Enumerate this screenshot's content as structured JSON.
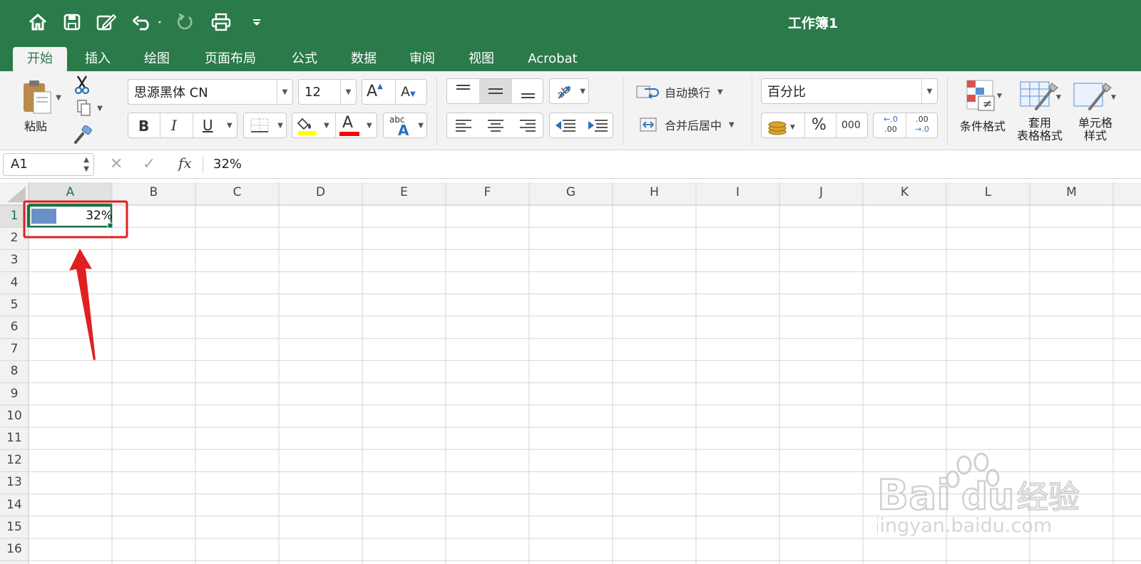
{
  "window": {
    "title": "工作簿1"
  },
  "quick_access": {
    "icons": [
      "home-icon",
      "save-icon",
      "edit-icon",
      "undo-icon",
      "redo-icon",
      "print-icon",
      "customize-icon"
    ]
  },
  "tabs": [
    {
      "label": "开始",
      "active": true
    },
    {
      "label": "插入"
    },
    {
      "label": "绘图"
    },
    {
      "label": "页面布局"
    },
    {
      "label": "公式"
    },
    {
      "label": "数据"
    },
    {
      "label": "审阅"
    },
    {
      "label": "视图"
    },
    {
      "label": "Acrobat"
    }
  ],
  "ribbon": {
    "paste_label": "粘贴",
    "font_name": "思源黑体 CN",
    "font_size": "12",
    "bold": "B",
    "italic": "I",
    "underline": "U",
    "font_color_letter": "A",
    "phonetic_top": "abc",
    "phonetic_letter": "A",
    "wrap_text": "自动换行",
    "merge_center": "合并后居中",
    "number_format": "百分比",
    "percent": "%",
    "comma": "000",
    "increase_decimal_top": "←.0",
    "increase_decimal_bottom": ".00",
    "decrease_decimal_top": ".00",
    "decrease_decimal_bottom": "→.0",
    "conditional_format": "条件格式",
    "format_as_table_line1": "套用",
    "format_as_table_line2": "表格格式",
    "cell_styles_line1": "单元格",
    "cell_styles_line2": "样式",
    "colors": {
      "fill_highlight": "#ffff00",
      "font_color": "#ff0000"
    }
  },
  "formula_bar": {
    "name_box": "A1",
    "fx": "fx",
    "value": "32%"
  },
  "sheet": {
    "columns": [
      "A",
      "B",
      "C",
      "D",
      "E",
      "F",
      "G",
      "H",
      "I",
      "J",
      "K",
      "L",
      "M"
    ],
    "rows": [
      "1",
      "2",
      "3",
      "4",
      "5",
      "6",
      "7",
      "8",
      "9",
      "10",
      "11",
      "12",
      "13",
      "14",
      "15",
      "16"
    ],
    "selected_cell": "A1",
    "cell_a1": {
      "value": "32%",
      "data_bar_fraction": 0.32,
      "data_bar_color": "#6b8fc9"
    }
  },
  "annotation": {
    "color": "#e02020"
  },
  "watermark": {
    "brand": "Bai du 经验",
    "url": "jingyan.baidu.com"
  }
}
